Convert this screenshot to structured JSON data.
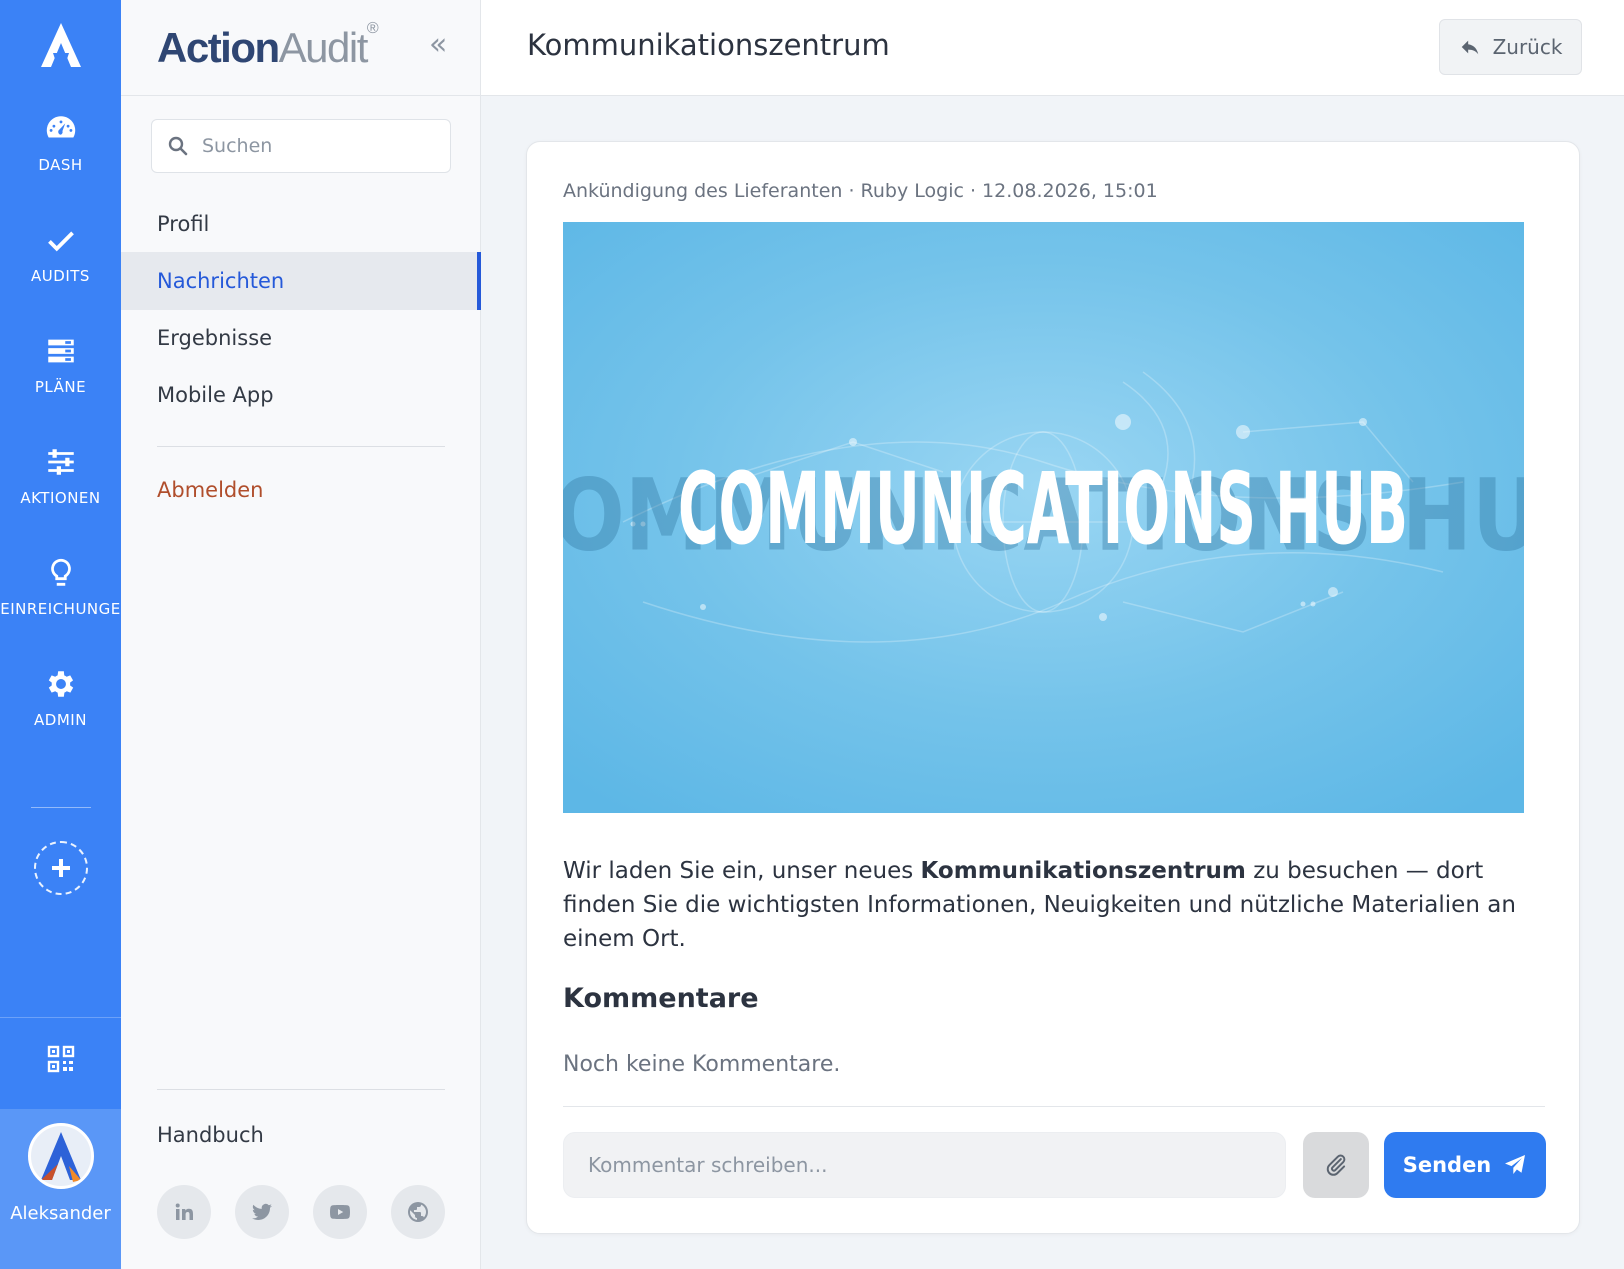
{
  "rail": {
    "items": [
      {
        "label": "DASH",
        "icon": "gauge-icon"
      },
      {
        "label": "AUDITS",
        "icon": "check-icon"
      },
      {
        "label": "PLÄNE",
        "icon": "plans-icon"
      },
      {
        "label": "AKTIONEN",
        "icon": "sliders-icon"
      },
      {
        "label": "EINREICHUNGE",
        "icon": "lightbulb-icon"
      },
      {
        "label": "ADMIN",
        "icon": "gear-icon"
      }
    ],
    "user_name": "Aleksander"
  },
  "sidebar": {
    "brand_part1": "Action",
    "brand_part2": "Audit",
    "brand_mark": "®",
    "collapse_glyph": "«",
    "search_placeholder": "Suchen",
    "nav": [
      {
        "label": "Profil"
      },
      {
        "label": "Nachrichten",
        "active": true
      },
      {
        "label": "Ergebnisse"
      },
      {
        "label": "Mobile App"
      }
    ],
    "logout_label": "Abmelden",
    "manual_label": "Handbuch",
    "socials": [
      "linkedin-icon",
      "twitter-icon",
      "youtube-icon",
      "globe-icon"
    ]
  },
  "header": {
    "title": "Kommunikationszentrum",
    "back_label": "Zurück"
  },
  "post": {
    "meta": "Ankündigung des Lieferanten · Ruby Logic · 12.08.2026, 15:01",
    "hero_text": "COMMUNICATIONS HUB",
    "body_part1": "Wir laden Sie ein, unser neues ",
    "body_bold": "Kommunikationszentrum",
    "body_part2": " zu besuchen — dort finden Sie die wichtigsten Informationen, Neuigkeiten und nützliche Materialien an einem Ort."
  },
  "comments": {
    "heading": "Kommentare",
    "empty_text": "Noch keine Kommentare.",
    "input_placeholder": "Kommentar schreiben...",
    "send_label": "Senden"
  },
  "colors": {
    "rail": "#3b82f6",
    "accent": "#2559d9",
    "send": "#2f7bf0",
    "logout": "#b04e2c",
    "hero_bg": "#6fc0ea"
  }
}
